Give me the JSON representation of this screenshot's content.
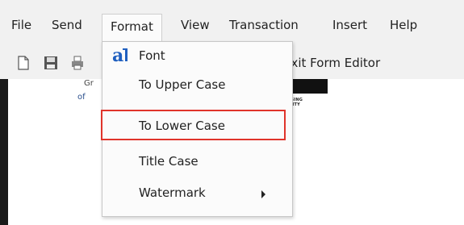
{
  "menubar": {
    "items": [
      "File",
      "Send",
      "Format",
      "View",
      "Transaction",
      "Insert",
      "Help"
    ]
  },
  "toolbar": {
    "exit_label": "Exit Form Editor",
    "icons": [
      "new-document-icon",
      "save-icon",
      "print-icon"
    ]
  },
  "document": {
    "frag1": "Gr",
    "frag2": "of",
    "logo_text_1": "AL HOUSING",
    "logo_text_2": "PORTUNITY"
  },
  "format_menu": {
    "items": [
      {
        "label": "Font",
        "icon": "font-icon"
      },
      {
        "label": "To Upper Case"
      },
      {
        "label": "To Lower Case",
        "highlighted": true
      },
      {
        "label": "Title Case"
      },
      {
        "label": "Watermark",
        "submenu": true
      }
    ],
    "font_icon_glyph": "a",
    "highlight_color": "#e0342b"
  }
}
